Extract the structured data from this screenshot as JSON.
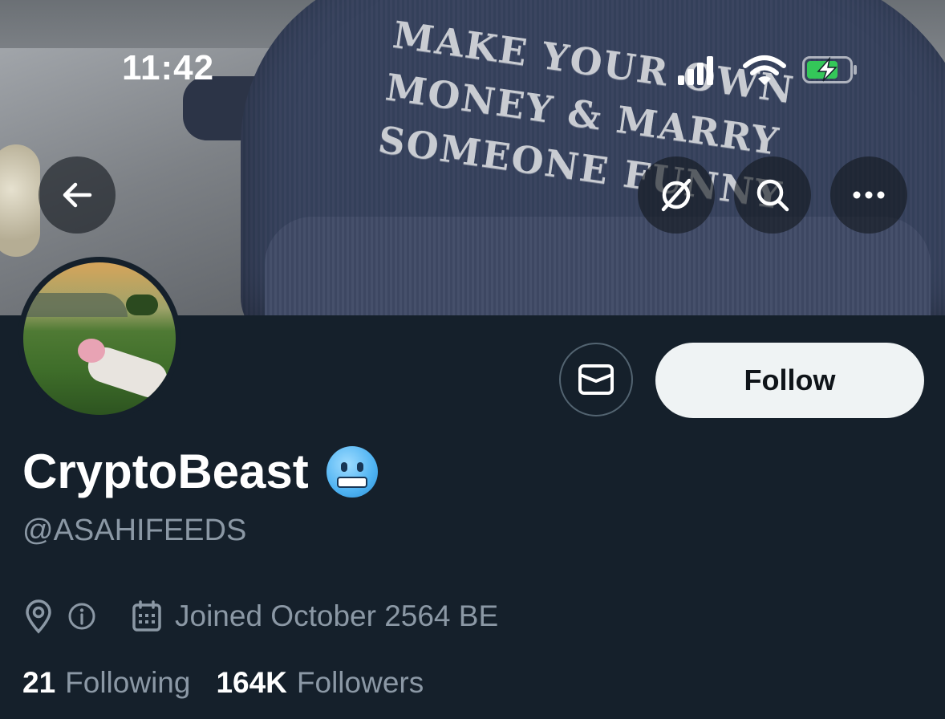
{
  "status_bar": {
    "time": "11:42"
  },
  "banner": {
    "hat_text_lines": [
      "MAKE YOUR OWN",
      "MONEY & MARRY",
      "SOMEONE FUNNY"
    ]
  },
  "nav": {
    "back_icon": "arrow-left-icon",
    "translate_icon": "translate-off-icon",
    "search_icon": "search-icon",
    "more_icon": "more-horizontal-icon"
  },
  "actions": {
    "message_icon": "envelope-icon",
    "follow_label": "Follow"
  },
  "profile": {
    "display_name": "CryptoBeast",
    "name_emoji": "cold-face-emoji",
    "handle": "@ASAHIFEEDS",
    "joined": "Joined October 2564 BE",
    "following_count": "21",
    "following_label": "Following",
    "followers_count": "164K",
    "followers_label": "Followers"
  },
  "colors": {
    "background": "#15202b",
    "secondary_text": "#8b98a5",
    "follow_button_bg": "#eff3f4",
    "battery_green": "#34c759"
  }
}
